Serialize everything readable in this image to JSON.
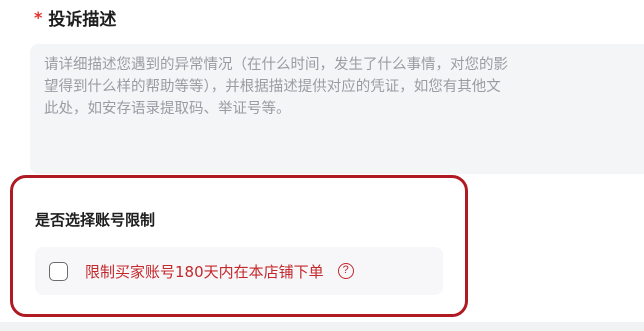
{
  "complaint_description": {
    "required_mark": "*",
    "label": "投诉描述",
    "textarea_placeholder": "请详细描述您遇到的异常情况（在什么时间，发生了什么事情，对您的影\n望得到什么样的帮助等等），并根据描述提供对应的凭证，如您有其他文\n此处，如安存语录提取码、举证号等。"
  },
  "account_restriction": {
    "title": "是否选择账号限制",
    "option_label": "限制买家账号180天内在本店铺下单",
    "option_checked": false,
    "help_icon_glyph": "?"
  },
  "colors": {
    "required": "#e5322d",
    "highlight_border": "#b01a22",
    "option_text": "#c4282b"
  }
}
